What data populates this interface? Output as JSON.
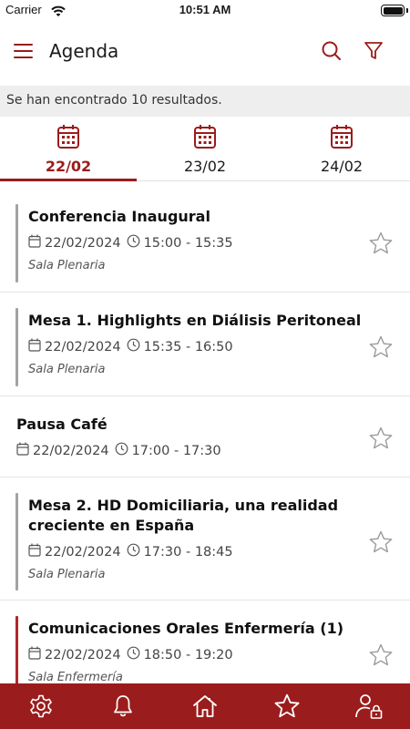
{
  "status_bar": {
    "carrier": "Carrier",
    "time": "10:51 AM"
  },
  "header": {
    "title": "Agenda"
  },
  "icons": {
    "menu": "hamburger-menu-icon",
    "search": "search-icon",
    "filter": "filter-funnel-icon",
    "calendar": "calendar-icon",
    "clock": "clock-icon",
    "star": "star-outline-icon",
    "nav": [
      "gear-icon",
      "bell-icon",
      "home-icon",
      "star-icon",
      "user-lock-icon"
    ]
  },
  "colors": {
    "brand": "#9b1c1c",
    "separator_gray": "#a3a3a3",
    "separator_red": "#b3262a",
    "banner_bg": "#eeeeee"
  },
  "results_text": "Se han encontrado 10 resultados.",
  "tabs": [
    {
      "label": "22/02",
      "active": true
    },
    {
      "label": "23/02",
      "active": false
    },
    {
      "label": "24/02",
      "active": false
    }
  ],
  "events": [
    {
      "title": "Conferencia Inaugural",
      "date": "22/02/2024",
      "time": "15:00 - 15:35",
      "room": "Sala Plenaria"
    },
    {
      "title": "Mesa 1. Highlights en Diálisis Peritoneal",
      "date": "22/02/2024",
      "time": "15:35 - 16:50",
      "room": "Sala Plenaria"
    },
    {
      "title": "Pausa Café",
      "date": "22/02/2024",
      "time": "17:00 - 17:30",
      "room": ""
    },
    {
      "title_line1": "Mesa 2. HD Domiciliaria, una realidad",
      "title_line2": "creciente en España",
      "date": "22/02/2024",
      "time": "17:30 - 18:45",
      "room": "Sala Plenaria"
    },
    {
      "title": "Comunicaciones Orales Enfermería (1)",
      "date": "22/02/2024",
      "time": "18:50 - 19:20",
      "room": "Sala Enfermería"
    }
  ]
}
